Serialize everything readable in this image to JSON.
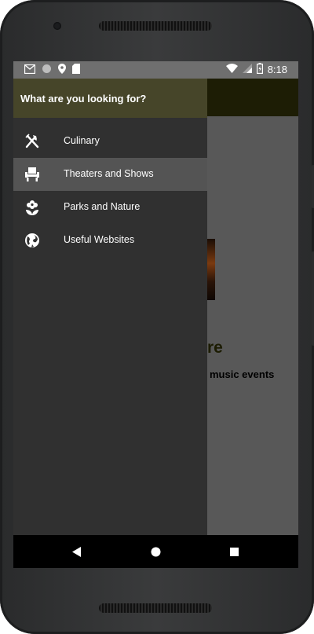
{
  "status_bar": {
    "time": "8:18",
    "left_icons": [
      "gmail-icon",
      "sync-icon",
      "location-icon",
      "sd-card-icon"
    ],
    "right_icons": [
      "wifi-icon",
      "signal-icon",
      "battery-icon"
    ]
  },
  "drawer": {
    "header_title": "What are you looking for?",
    "items": [
      {
        "label": "Culinary",
        "icon": "fork-knife-icon",
        "selected": false
      },
      {
        "label": "Theaters and Shows",
        "icon": "seat-icon",
        "selected": true
      },
      {
        "label": "Parks and Nature",
        "icon": "flower-icon",
        "selected": false
      },
      {
        "label": "Useful Websites",
        "icon": "globe-icon",
        "selected": false
      }
    ]
  },
  "background_content": {
    "title_fragment": "re",
    "text_fragment": "music events"
  },
  "nav_bar": {
    "buttons": [
      "back-button",
      "home-button",
      "recents-button"
    ]
  },
  "colors": {
    "drawer_bg": "#303030",
    "drawer_header_bg": "#464529",
    "selected_item_bg": "#545454",
    "app_header_bg": "#1d1d05",
    "status_bar_bg": "#6f6f6f",
    "scrim_bg": "#585858"
  }
}
